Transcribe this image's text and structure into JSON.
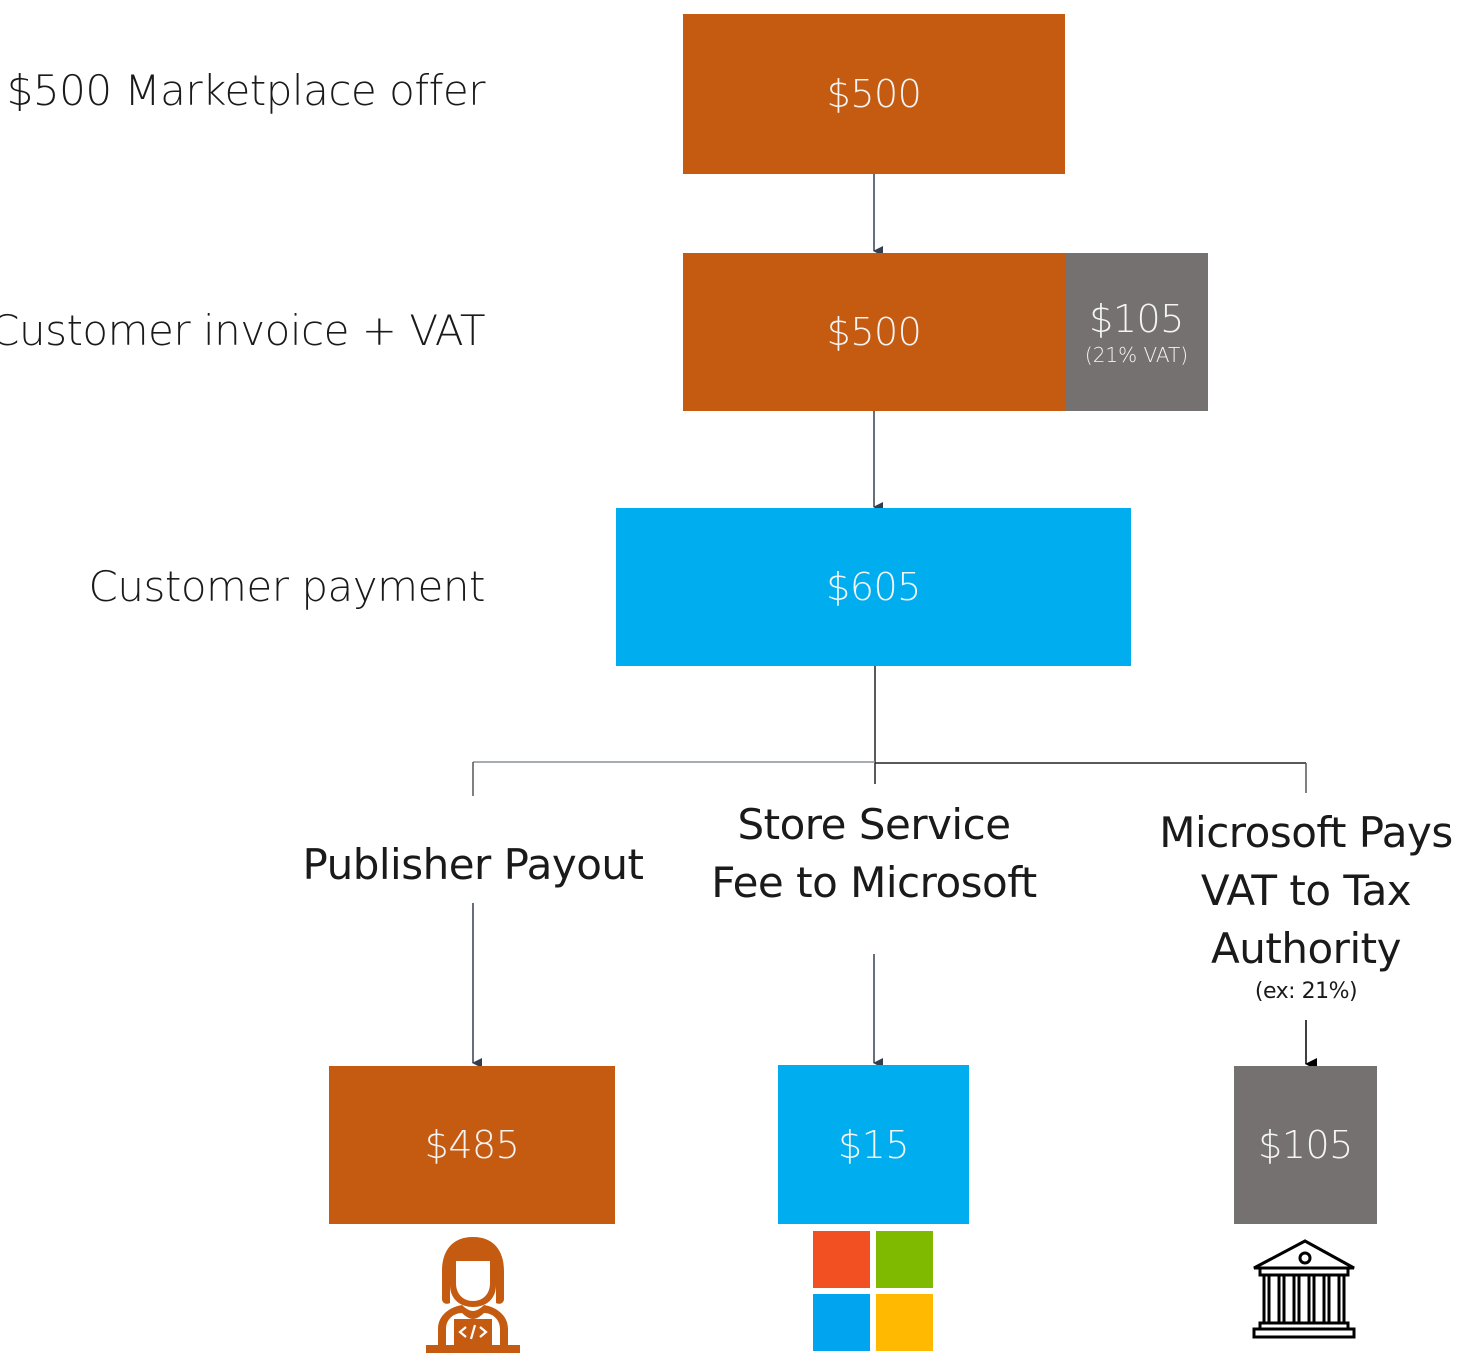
{
  "rows": {
    "offer": {
      "label": "$500 Marketplace offer",
      "amount": "$500"
    },
    "invoice": {
      "label": "Customer invoice + VAT",
      "amount": "$500",
      "vat_amount": "$105",
      "vat_note": "(21% VAT)"
    },
    "payment": {
      "label": "Customer payment",
      "amount": "$605"
    }
  },
  "branches": {
    "publisher": {
      "label": "Publisher Payout",
      "amount": "$485",
      "icon": "developer-icon"
    },
    "store_fee": {
      "label_line1": "Store Service",
      "label_line2": "Fee to Microsoft",
      "amount": "$15",
      "icon": "microsoft-logo-icon"
    },
    "tax": {
      "label_line1": "Microsoft Pays",
      "label_line2": "VAT to Tax",
      "label_line3": "Authority",
      "note": "(ex: 21%)",
      "amount": "$105",
      "icon": "government-building-icon"
    }
  },
  "colors": {
    "publisher_orange": "#c55a11",
    "microsoft_blue": "#00adef",
    "vat_gray": "#767171",
    "ms_logo": [
      "#f25022",
      "#7fba00",
      "#00a4ef",
      "#ffb900"
    ]
  }
}
